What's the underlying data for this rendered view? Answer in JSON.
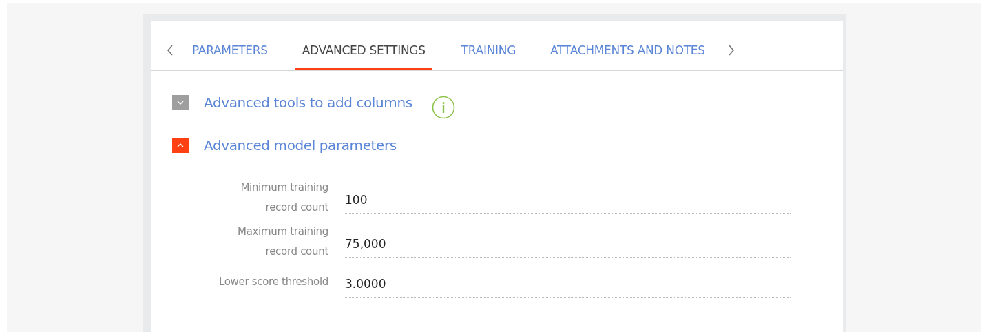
{
  "tabs": [
    {
      "label": "PARAMETERS",
      "selected": false
    },
    {
      "label": "ADVANCED SETTINGS",
      "selected": true
    },
    {
      "label": "TRAINING",
      "selected": false
    },
    {
      "label": "ATTACHMENTS AND NOTES",
      "selected": false
    }
  ],
  "sections": [
    {
      "title": "Advanced tools to add columns",
      "expanded": false,
      "info": true
    },
    {
      "title": "Advanced model parameters",
      "expanded": true,
      "info": false
    }
  ],
  "fields": [
    {
      "label": "Minimum training record count",
      "value": "100"
    },
    {
      "label": "Maximum training record count",
      "value": "75,000"
    },
    {
      "label": "Lower score threshold",
      "value": "3.0000"
    }
  ]
}
